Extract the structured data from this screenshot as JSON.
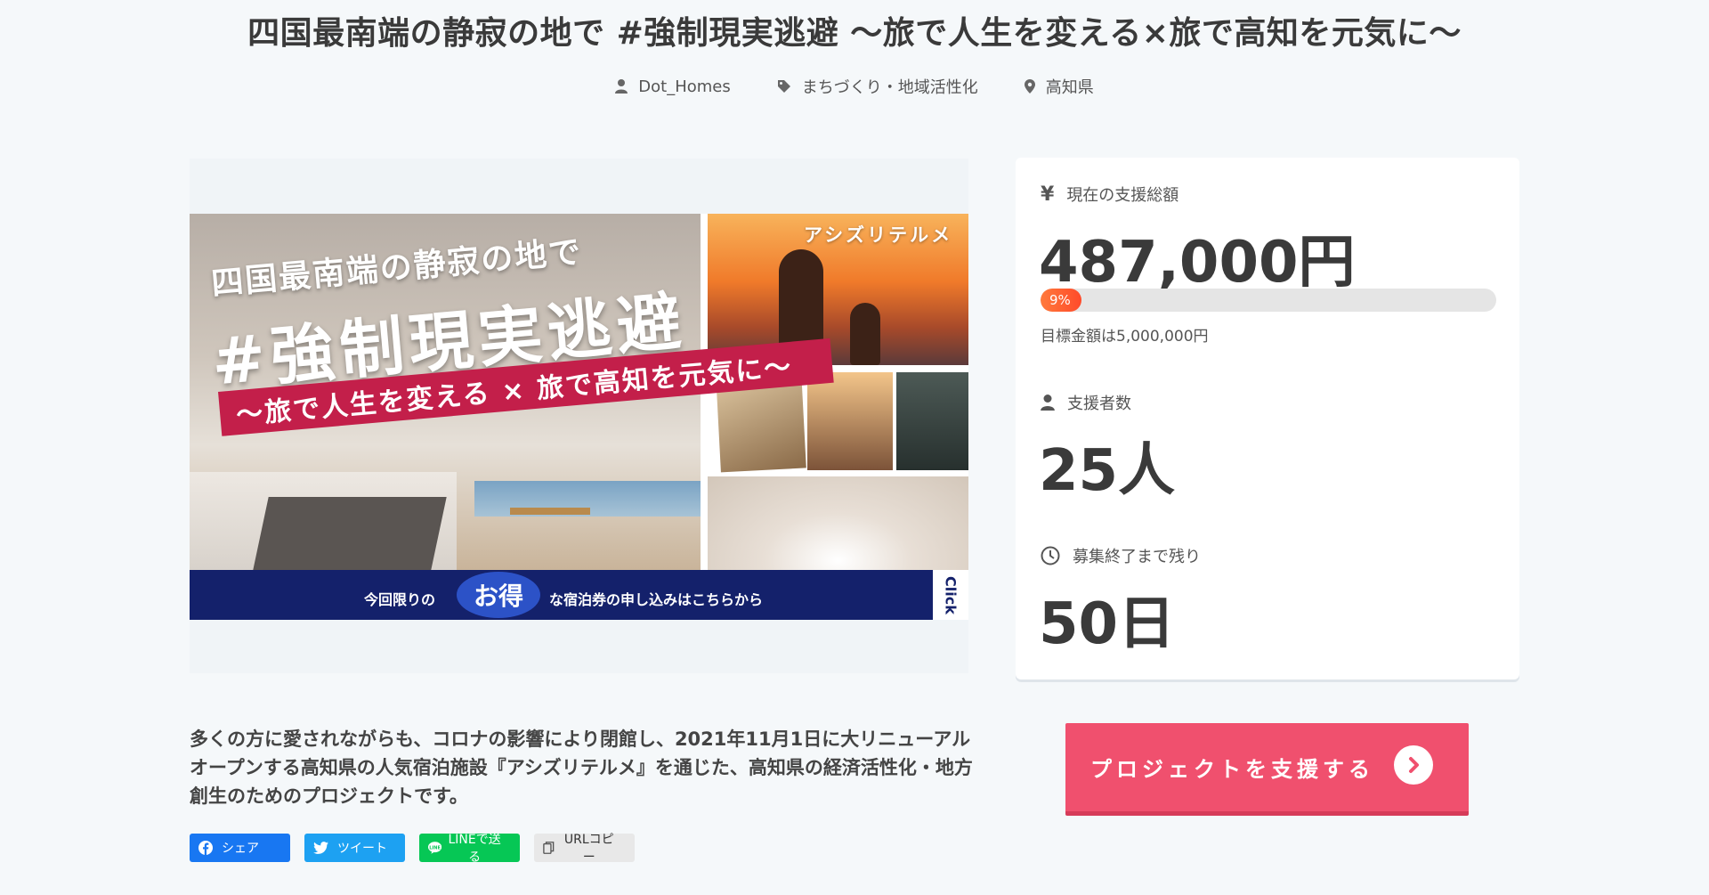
{
  "project": {
    "title": "四国最南端の静寂の地で #強制現実逃避 〜旅で人生を変える×旅で高知を元気に〜",
    "owner": "Dot_Homes",
    "category": "まちづくり・地域活性化",
    "location": "高知県"
  },
  "hero": {
    "brand_tag": "アシズリテルメ",
    "line1": "四国最南端の静寂の地で",
    "line2": "#強制現実逃避",
    "ribbon": "〜旅で人生を変える × 旅で高知を元気に〜",
    "bar_text1": "今回限りの",
    "bar_highlight": "お得",
    "bar_text2": "な宿泊券の申し込みはこちらから",
    "click": "Click"
  },
  "stats": {
    "total_label": "現在の支援総額",
    "total_value": "487,000円",
    "progress_percent": 9,
    "progress_label": "9%",
    "goal_text": "目標金額は5,000,000円",
    "supporters_label": "支援者数",
    "supporters_value": "25人",
    "remaining_label": "募集終了まで残り",
    "remaining_value": "50日"
  },
  "description": "多くの方に愛されながらも、コロナの影響により閉館し、2021年11月1日に大リニューアルオープンする高知県の人気宿泊施設『アシズリテルメ』を通じた、高知県の経済活性化・地方創生のためのプロジェクトです。",
  "share": {
    "facebook": "シェア",
    "twitter": "ツイート",
    "line": "LINEで送る",
    "url_copy": "URLコピー"
  },
  "cta": {
    "support_label": "プロジェクトを支援する"
  },
  "colors": {
    "accent": "#f0506e",
    "progress": "#ff5a2e",
    "facebook": "#1877f2",
    "twitter": "#1da1f2",
    "line": "#06c755"
  }
}
